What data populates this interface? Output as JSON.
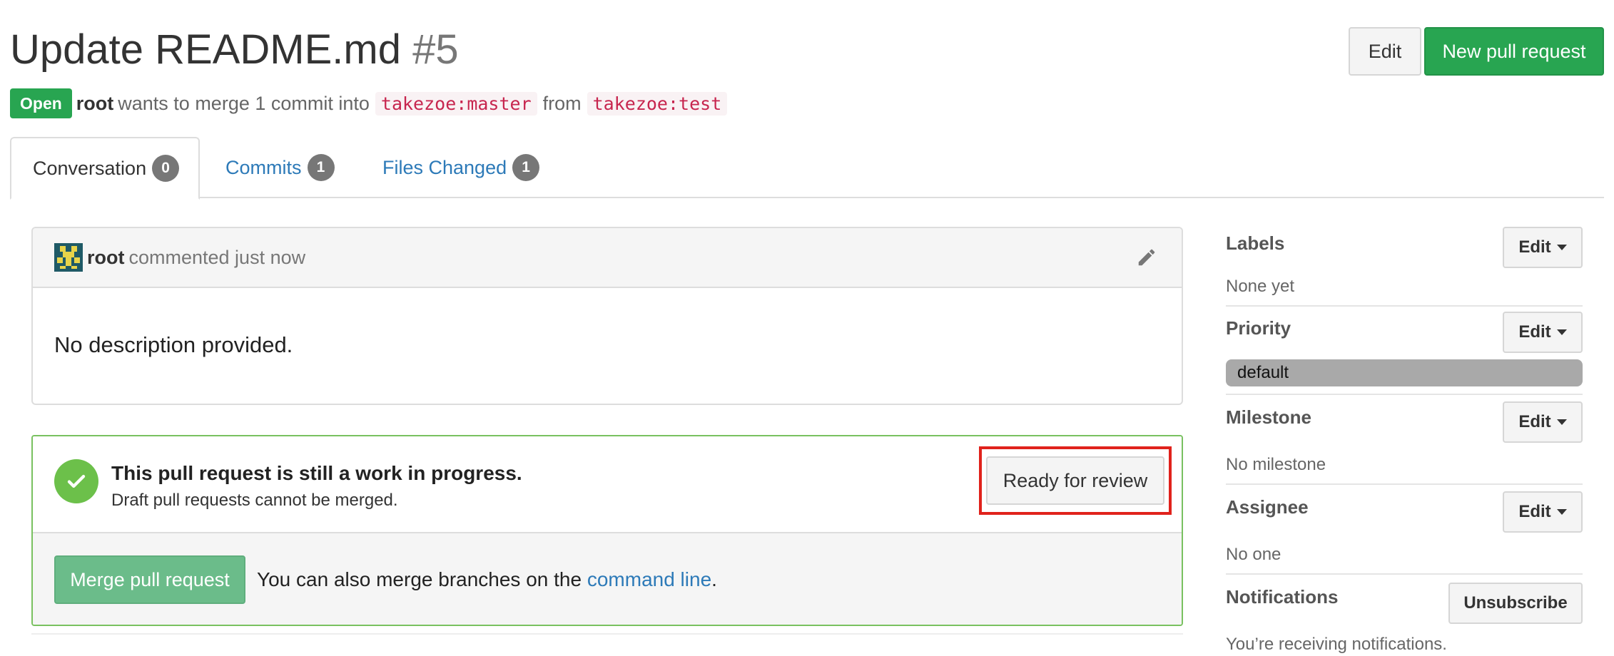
{
  "header": {
    "title": "Update README.md",
    "number": "#5",
    "edit_label": "Edit",
    "new_pr_label": "New pull request"
  },
  "status": {
    "badge": "Open",
    "user": "root",
    "text_merge": "wants to merge 1 commit into",
    "base_branch": "takezoe:master",
    "text_from": "from",
    "head_branch": "takezoe:test"
  },
  "tabs": [
    {
      "label": "Conversation",
      "count": "0"
    },
    {
      "label": "Commits",
      "count": "1"
    },
    {
      "label": "Files Changed",
      "count": "1"
    }
  ],
  "comment": {
    "user": "root",
    "meta": "commented just now",
    "body": "No description provided."
  },
  "merge": {
    "wip_title": "This pull request is still a work in progress.",
    "wip_sub": "Draft pull requests cannot be merged.",
    "ready_label": "Ready for review",
    "merge_label": "Merge pull request",
    "alt_text_pre": "You can also merge branches on the",
    "alt_link": "command line",
    "alt_text_post": "."
  },
  "sidebar": {
    "labels": {
      "title": "Labels",
      "edit": "Edit",
      "value": "None yet"
    },
    "priority": {
      "title": "Priority",
      "edit": "Edit",
      "value": "default"
    },
    "milestone": {
      "title": "Milestone",
      "edit": "Edit",
      "value": "No milestone"
    },
    "assignee": {
      "title": "Assignee",
      "edit": "Edit",
      "value": "No one"
    },
    "notifications": {
      "title": "Notifications",
      "button": "Unsubscribe",
      "value": "You’re receiving notifications."
    }
  },
  "colors": {
    "success": "#28a551",
    "link": "#2d7ab8",
    "branch": "#c7254e",
    "highlight": "#e0221c",
    "priority_default": "#a9a9a9"
  }
}
